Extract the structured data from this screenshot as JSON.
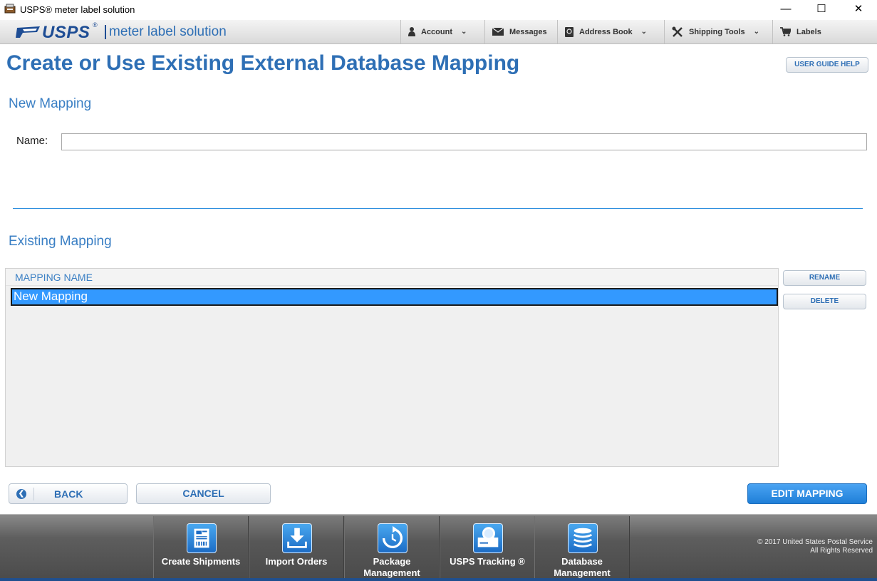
{
  "window": {
    "title": "USPS® meter label solution",
    "minimize": "—",
    "maximize": "☐",
    "close": "✕"
  },
  "header": {
    "logo_text": "USPS",
    "logo_trademark": "®",
    "logo_subtitle": "meter label solution",
    "nav": [
      {
        "label": "Account",
        "icon": "person-icon",
        "has_dropdown": true
      },
      {
        "label": "Messages",
        "icon": "envelope-icon",
        "has_dropdown": false
      },
      {
        "label": "Address Book",
        "icon": "address-book-icon",
        "has_dropdown": true
      },
      {
        "label": "Shipping Tools",
        "icon": "tools-icon",
        "has_dropdown": true
      },
      {
        "label": "Labels",
        "icon": "cart-icon",
        "has_dropdown": false
      }
    ],
    "chevron": "⌄"
  },
  "main": {
    "title": "Create or Use Existing External Database Mapping",
    "help_button": "USER GUIDE HELP",
    "new_mapping": {
      "heading": "New Mapping",
      "name_label": "Name:",
      "name_value": ""
    },
    "existing_mapping": {
      "heading": "Existing Mapping",
      "columns": [
        "MAPPING NAME"
      ],
      "rows": [
        {
          "name": "New Mapping",
          "selected": true
        }
      ],
      "rename_button": "RENAME",
      "delete_button": "DELETE"
    },
    "back_button": "BACK",
    "cancel_button": "CANCEL",
    "edit_button": "EDIT MAPPING"
  },
  "footer": {
    "tiles": [
      {
        "label": "Create Shipments",
        "icon": "shipment-label-icon"
      },
      {
        "label": "Import Orders",
        "icon": "import-download-icon"
      },
      {
        "label": "Package Management",
        "icon": "package-refresh-icon"
      },
      {
        "label": "USPS Tracking ®",
        "icon": "tracking-magnifier-icon"
      },
      {
        "label": "Database Management",
        "icon": "database-icon"
      }
    ],
    "copyright_line1": "© 2017 United States Postal Service",
    "copyright_line2": "All Rights Reserved"
  },
  "colors": {
    "brand_blue": "#2e6fb5",
    "selection_blue": "#3399ff",
    "primary_button": "#1f7fd8"
  }
}
